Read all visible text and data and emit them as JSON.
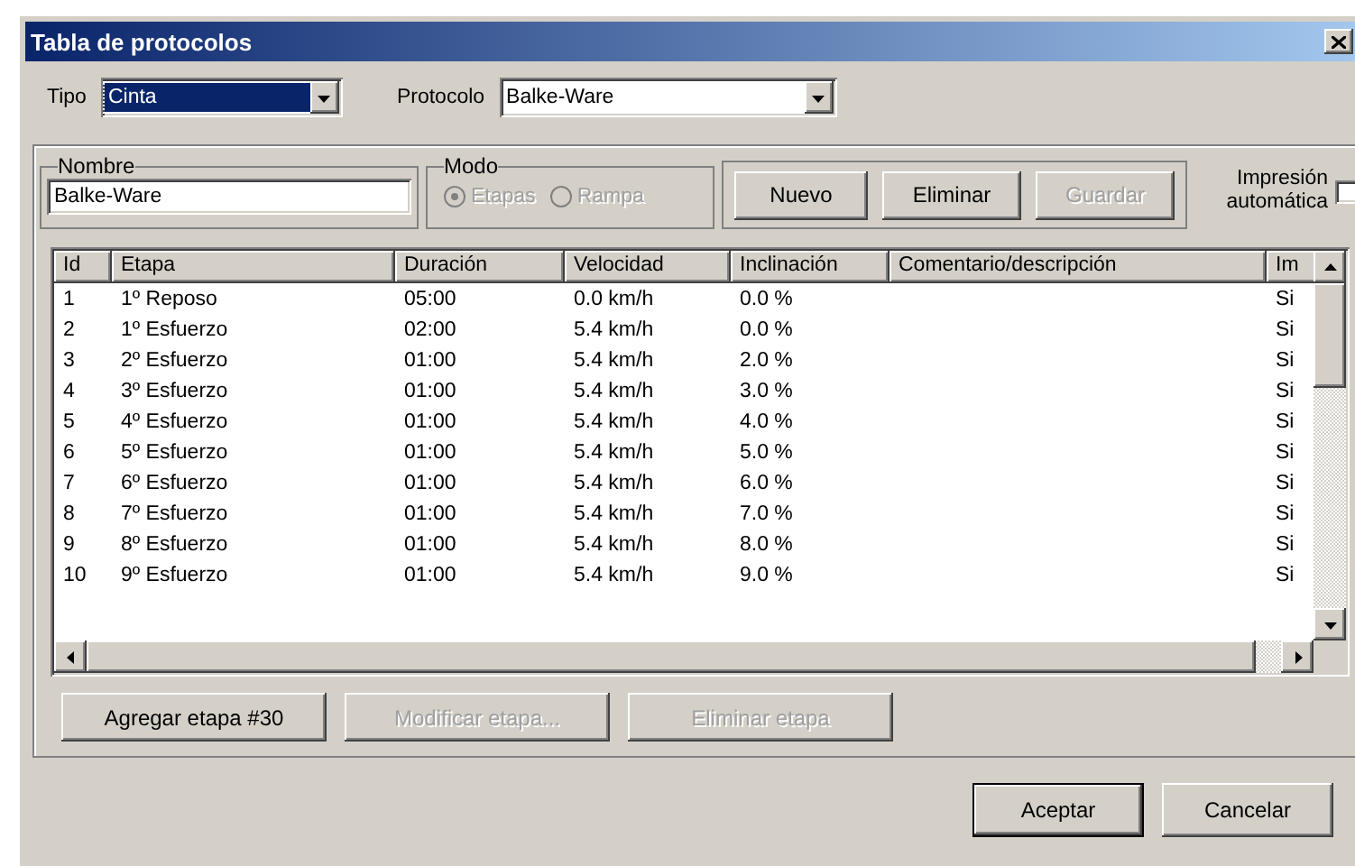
{
  "window": {
    "title": "Tabla de protocolos"
  },
  "tipo": {
    "label": "Tipo",
    "value": "Cinta",
    "focused": true
  },
  "protocolo": {
    "label": "Protocolo",
    "value": "Balke-Ware",
    "focused": false
  },
  "nombre": {
    "legend": "Nombre",
    "value": "Balke-Ware"
  },
  "modo": {
    "legend": "Modo",
    "disabled": true,
    "options": [
      {
        "label": "Etapas",
        "selected": true
      },
      {
        "label": "Rampa",
        "selected": false
      }
    ]
  },
  "actions": [
    {
      "label": "Nuevo",
      "disabled": false
    },
    {
      "label": "Eliminar",
      "disabled": false
    },
    {
      "label": "Guardar",
      "disabled": true
    }
  ],
  "auto_print": {
    "label": "Impresión automática",
    "checked": false
  },
  "table": {
    "columns": [
      "Id",
      "Etapa",
      "Duración",
      "Velocidad",
      "Inclinación",
      "Comentario/descripción",
      "Im"
    ],
    "rows": [
      {
        "id": "1",
        "etapa": "1º Reposo",
        "duracion": "05:00",
        "velocidad": "0.0 km/h",
        "inclinacion": "0.0 %",
        "column_7": "Si"
      },
      {
        "id": "2",
        "etapa": "1º Esfuerzo",
        "duracion": "02:00",
        "velocidad": "5.4 km/h",
        "inclinacion": "0.0 %",
        "column_7": "Si"
      },
      {
        "id": "3",
        "etapa": "2º Esfuerzo",
        "duracion": "01:00",
        "velocidad": "5.4 km/h",
        "inclinacion": "2.0 %",
        "column_7": "Si"
      },
      {
        "id": "4",
        "etapa": "3º Esfuerzo",
        "duracion": "01:00",
        "velocidad": "5.4 km/h",
        "inclinacion": "3.0 %",
        "column_7": "Si"
      },
      {
        "id": "5",
        "etapa": "4º Esfuerzo",
        "duracion": "01:00",
        "velocidad": "5.4 km/h",
        "inclinacion": "4.0 %",
        "column_7": "Si"
      },
      {
        "id": "6",
        "etapa": "5º Esfuerzo",
        "duracion": "01:00",
        "velocidad": "5.4 km/h",
        "inclinacion": "5.0 %",
        "column_7": "Si"
      },
      {
        "id": "7",
        "etapa": "6º Esfuerzo",
        "duracion": "01:00",
        "velocidad": "5.4 km/h",
        "inclinacion": "6.0 %",
        "column_7": "Si"
      },
      {
        "id": "8",
        "etapa": "7º Esfuerzo",
        "duracion": "01:00",
        "velocidad": "5.4 km/h",
        "inclinacion": "7.0 %",
        "column_7": "Si"
      },
      {
        "id": "9",
        "etapa": "8º Esfuerzo",
        "duracion": "01:00",
        "velocidad": "5.4 km/h",
        "inclinacion": "8.0 %",
        "column_7": "Si"
      },
      {
        "id": "10",
        "etapa": "9º Esfuerzo",
        "duracion": "01:00",
        "velocidad": "5.4 km/h",
        "inclinacion": "9.0 %",
        "column_7": "Si"
      }
    ]
  },
  "stage_buttons": [
    {
      "label": "Agregar etapa #30",
      "disabled": false
    },
    {
      "label": "Modificar etapa...",
      "disabled": true
    },
    {
      "label": "Eliminar etapa",
      "disabled": true
    }
  ],
  "footer_buttons": [
    {
      "label": "Aceptar",
      "default": true
    },
    {
      "label": "Cancelar",
      "default": false
    }
  ]
}
